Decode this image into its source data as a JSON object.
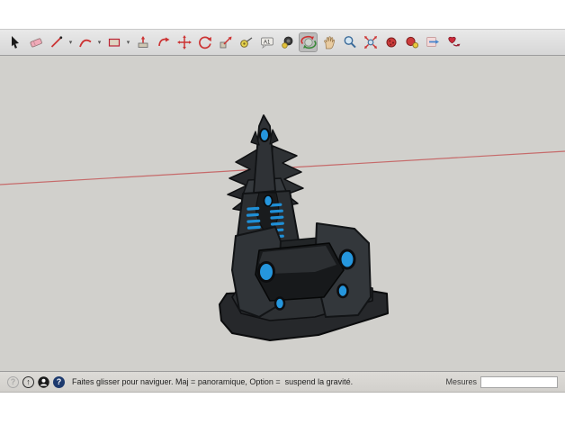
{
  "toolbar": {
    "active_tool": "orbit",
    "tools": [
      "select",
      "eraser",
      "line",
      "arc",
      "rectangle",
      "push-pull",
      "follow-me",
      "move",
      "rotate",
      "scale",
      "tape-measure",
      "text",
      "paint-bucket",
      "orbit",
      "pan",
      "zoom",
      "zoom-extents",
      "physics-settings",
      "physics-objects",
      "physics-export",
      "physics-play"
    ],
    "dropdown_glyph": "▾"
  },
  "viewport": {
    "background_color": "#d1d0cc",
    "axis_line_color": "#c66a6a",
    "model_name": "black-and-blue-throne",
    "model_body_color": "#2b2e31",
    "model_accent_color": "#2596dd"
  },
  "statusbar": {
    "icon_glyphs": {
      "help": "?",
      "up": "↑",
      "question": "?"
    },
    "message": "Faites glisser pour naviguer. Maj = panoramique, Option =  suspend la gravité.",
    "measure": {
      "label": "Mesures",
      "value": ""
    }
  }
}
